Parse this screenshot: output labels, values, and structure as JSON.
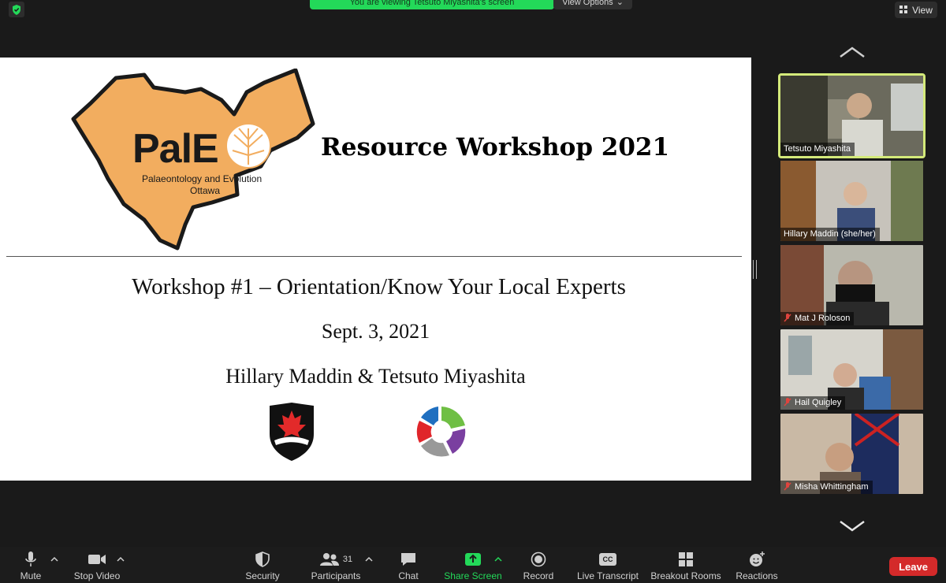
{
  "top": {
    "viewing_banner": "You are viewing Tetsuto Miyashita's screen",
    "view_options": "View Options",
    "view_button": "View"
  },
  "slide": {
    "logo_main": "PalE",
    "logo_line1": "Palaeontology and Evolution",
    "logo_line2": "Ottawa",
    "title": "Resource Workshop 2021",
    "subtitle": "Workshop #1 – Orientation/Know Your Local Experts",
    "date": "Sept. 3, 2021",
    "presenters": "Hillary Maddin & Tetsuto Miyashita"
  },
  "gallery": {
    "participants": [
      {
        "name": "Tetsuto Miyashita",
        "muted": false,
        "active": true
      },
      {
        "name": "Hillary Maddin (she/her)",
        "muted": false,
        "active": false
      },
      {
        "name": "Mat J Roloson",
        "muted": true,
        "active": false
      },
      {
        "name": "Hail Quigley",
        "muted": true,
        "active": false
      },
      {
        "name": "Misha Whittingham",
        "muted": true,
        "active": false
      }
    ]
  },
  "toolbar": {
    "mute": "Mute",
    "stop_video": "Stop Video",
    "security": "Security",
    "participants": "Participants",
    "participant_count": "31",
    "chat": "Chat",
    "share_screen": "Share Screen",
    "record": "Record",
    "live_transcript": "Live Transcript",
    "cc_badge": "CC",
    "breakout_rooms": "Breakout Rooms",
    "reactions": "Reactions",
    "leave": "Leave"
  },
  "colors": {
    "share_green": "#23d959",
    "active_outline": "#d4ea7a",
    "leave_red": "#d42a2a",
    "ottawa_orange": "#f2ad5f"
  }
}
